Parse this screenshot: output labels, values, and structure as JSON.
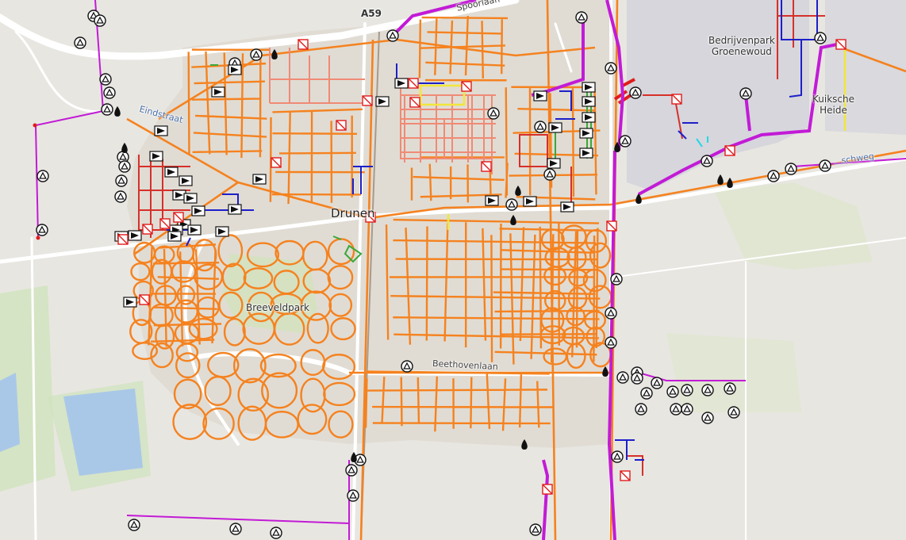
{
  "map": {
    "labels": {
      "town": "Drunen",
      "park": "Breeveldpark",
      "industry_line1": "Bedrijvenpark",
      "industry_line2": "Groenewoud",
      "area_line1": "Kuiksche",
      "area_line2": "Heide",
      "highway": "A59",
      "street_beethoven": "Beethovenlaan",
      "street_spoor": "Spoorlaan",
      "street_east": "...schweg",
      "street_west": "Eindstraat"
    },
    "colors": {
      "background": "#e8e6e1",
      "residential": "#e0dcd4",
      "industrial": "#d6d6dc",
      "park": "#cfe5b4",
      "water": "#a9c8e8",
      "network_orange": "#f5821f",
      "network_salmon": "#f08a75",
      "network_red": "#d6302a",
      "network_blue": "#1d1fc9",
      "network_magenta": "#c21bd6",
      "network_yellow": "#f2e63b",
      "network_green": "#3aa83a"
    },
    "icons": {
      "triangle": "triangle-marker-icon",
      "flag": "flag-marker-icon",
      "hydrant": "drop-marker-icon",
      "blocked": "blocked-square-icon"
    }
  }
}
